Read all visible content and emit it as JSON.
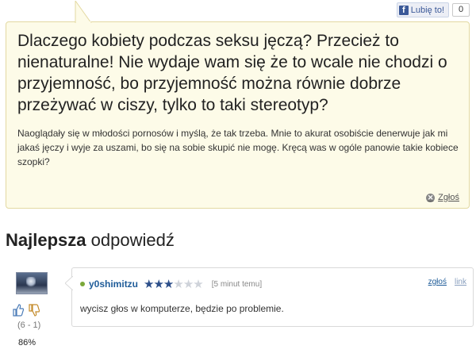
{
  "like_bar": {
    "like_label": "Lubię to!",
    "like_count": "0"
  },
  "question": {
    "title": "Dlaczego kobiety podczas seksu jęczą? Przecież to nienaturalne! Nie wydaje wam się że to wcale nie chodzi o przyjemność, bo przyjemność można równie dobrze przeżywać w ciszy, tylko to taki stereotyp?",
    "body": "Naoglądały się w młodości pornosów i myślą, że tak trzeba. Mnie to akurat osobiście denerwuje jak mi jakaś jęczy i wyje za uszami, bo się na sobie skupić nie mogę. Kręcą was w ogóle panowie takie kobiece szopki?",
    "report_label": "Zgłoś"
  },
  "best_answer": {
    "heading_bold": "Najlepsza",
    "heading_rest": "odpowiedź",
    "votes": {
      "detail": "(6 - 1)",
      "percent": "86%"
    },
    "author": "y0shimitzu",
    "rating": {
      "filled": 3,
      "total": 6
    },
    "time": "[5 minut temu]",
    "report_label": "zgłoś",
    "link_label": "link",
    "text": "wycisz głos w komputerze, będzie po problemie."
  },
  "icons": {
    "facebook": "facebook-icon",
    "report": "report-icon",
    "thumb_up": "thumb-up-icon",
    "thumb_down": "thumb-down-icon",
    "online": "online-status-icon",
    "star": "star-icon"
  },
  "colors": {
    "question_bg": "#fdfbe8",
    "question_border": "#e3d9a2",
    "username": "#1f5c99",
    "star_filled": "#2d4f8a"
  }
}
